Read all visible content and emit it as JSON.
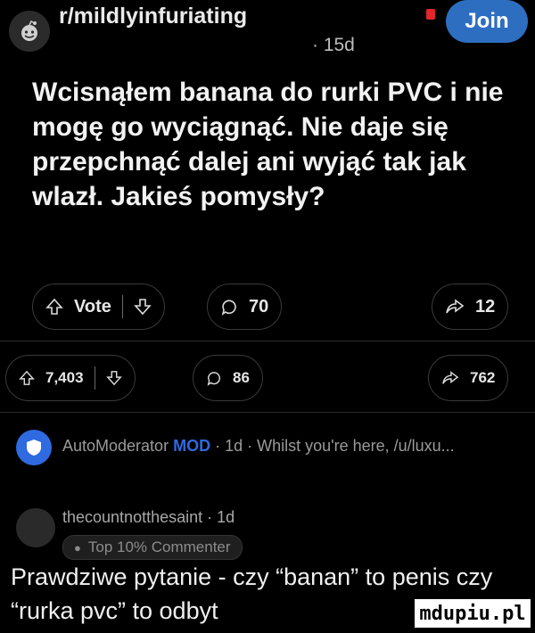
{
  "post": {
    "subreddit": "r/mildlyinfuriating",
    "age": "15d",
    "join_label": "Join",
    "title": "Wcisnąłem banana do rurki PVC i nie mogę go wyciągnąć. Nie daje się przepchnąć dalej ani wyjąć tak jak wlazł. Jakieś pomysły?",
    "vote_label": "Vote",
    "comments_count": "70",
    "shares_count": "12"
  },
  "post2_bar": {
    "votes": "7,403",
    "comments": "86",
    "shares": "762"
  },
  "automod": {
    "name": "AutoModerator",
    "mod_tag": "MOD",
    "meta": "· 1d · Whilst you're here, /u/luxu..."
  },
  "comment": {
    "username": "thecountnotthesaint",
    "age": "· 1d",
    "badge": "Top 10% Commenter",
    "text": "Prawdziwe pytanie - czy “banan” to penis czy “rurka pvc” to odbyt"
  },
  "watermark": "mdupiu.pl",
  "colors": {
    "join": "#2e6ec0",
    "mod": "#2f6ae0",
    "background": "#000000"
  }
}
